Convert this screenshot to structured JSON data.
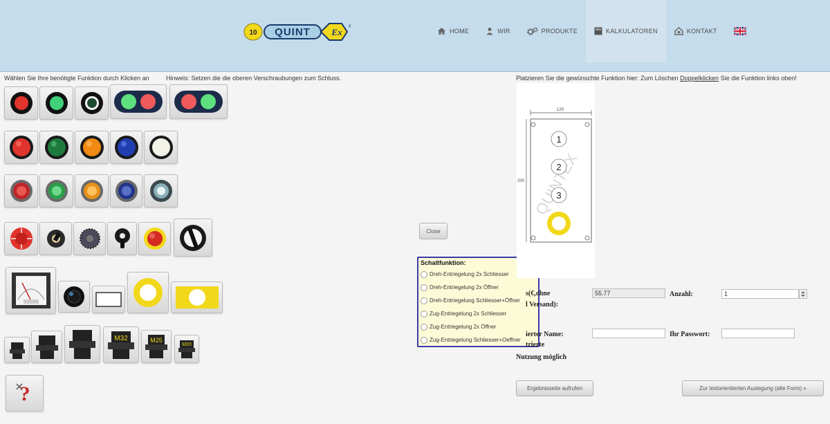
{
  "brand": {
    "badge": "10",
    "name": "QUINT",
    "mark": "Ex",
    "reg": "®"
  },
  "nav": [
    {
      "label": "HOME",
      "icon": "home-icon"
    },
    {
      "label": "WIR",
      "icon": "person-icon"
    },
    {
      "label": "PRODUKTE",
      "icon": "gears-icon"
    },
    {
      "label": "KALKULATOREN",
      "icon": "calculator-icon"
    },
    {
      "label": "KONTAKT",
      "icon": "contact-icon"
    },
    {
      "label": "",
      "icon": "uk-flag-icon"
    }
  ],
  "hints": {
    "left": "Wählen Sie Ihre benötigte Funktion durch Klicken an",
    "note": "Hinweis: Setzen die die oberen Verschraubungen zum Schluss.",
    "right_pre": "Platzieren Sie die gewünschte Funktion hier: Zum Löschen",
    "right_link": "Doppelklicken",
    "right_post": "Sie die Funktion links oben!"
  },
  "colors": {
    "header": "#c5dcec",
    "red": "#e0342c",
    "green": "#26a24f",
    "dark_green": "#1d7a3e",
    "orange": "#f08a12",
    "blue": "#1f3fb0",
    "yellow": "#f2d81a",
    "popup_border": "#3a3aa8",
    "popup_bg": "#fdfbd7"
  },
  "rows": {
    "lights": [
      "Indicator red",
      "Indicator green",
      "Indicator white",
      "Double green-red",
      "Double red-green"
    ],
    "buttons": [
      "Button red",
      "Button green",
      "Button orange",
      "Button blue",
      "Button white"
    ],
    "flush": [
      "Flush red",
      "Flush green",
      "Flush orange",
      "Flush blue",
      "Flush illuminated"
    ],
    "selectors": [
      "Emergency stop",
      "Key switch",
      "Rotary switch",
      "Selector handle",
      "Mushroom button",
      "Main switch"
    ],
    "misc": [
      "Meter",
      "Black knob",
      "Label plate",
      "Yellow ring",
      "Yellow plate"
    ],
    "glands": [
      "",
      "",
      "",
      "M32",
      "M25",
      "M20"
    ]
  },
  "close_label": "Close",
  "popup": {
    "title": "Schaltfunktion:",
    "options": [
      "Dreh-Entriegelung 2x Schliesser",
      "Dreh-Entriegelung 2x Öffner",
      "Dreh-Entriegelung Schliesser+Öffner",
      "Zug-Entriegelung 2x Schliesser",
      "Zug-Entriegelung 2x Öffner",
      "Zug-Entriegelung Schliesser+Oeffner"
    ]
  },
  "diagram": {
    "width_label": "120",
    "height_label": "200",
    "positions": [
      "1",
      "2",
      "3"
    ],
    "watermark": "QUINTEX"
  },
  "form": {
    "price_label_1": "s(€,ohne",
    "price_label_2": "l Versand):",
    "price_value": "55.77",
    "qty_label": "Anzahl:",
    "qty_value": "1",
    "user_label": "ierter Name:",
    "pass_label": "Ihr Passwort:",
    "note_1": "trierte",
    "note_2": "Nutzung möglich"
  },
  "actions": {
    "results": "Ergebnisseite aufrufen",
    "text_mode": "Zur textorientierten Auslegung (alte Form) »"
  }
}
